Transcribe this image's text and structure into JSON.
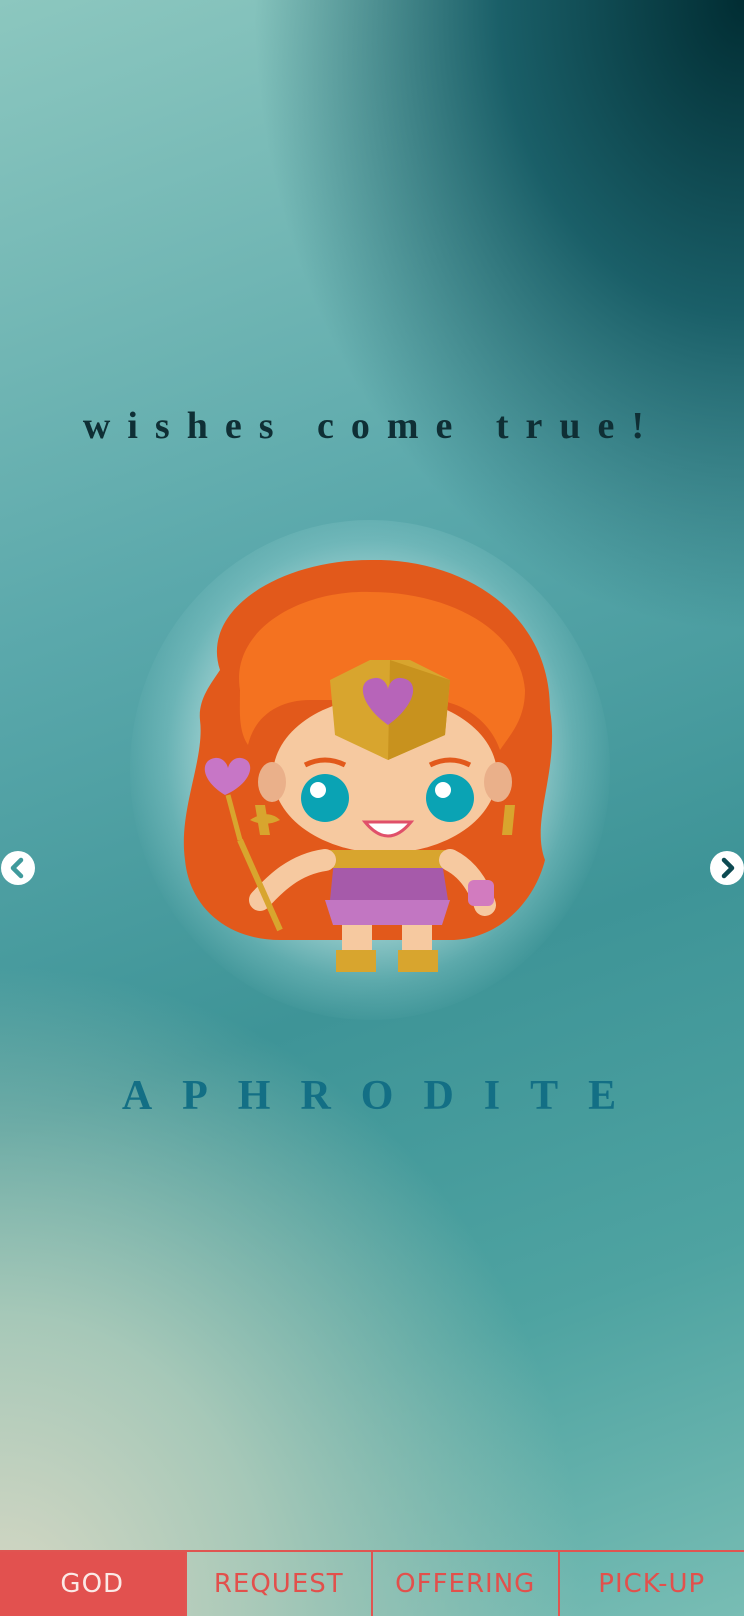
{
  "tagline": "wishes come true!",
  "god": {
    "name": "APHRODITE",
    "image": "aphrodite-character"
  },
  "carousel": {
    "prev_icon": "chevron-left-icon",
    "next_icon": "chevron-right-icon"
  },
  "tabs": [
    {
      "label": "GOD",
      "active": true
    },
    {
      "label": "REQUEST",
      "active": false
    },
    {
      "label": "OFFERING",
      "active": false
    },
    {
      "label": "PICK-UP",
      "active": false
    }
  ],
  "colors": {
    "accent": "#e2514f",
    "title": "#136f85",
    "tagline": "#0f2f35"
  }
}
